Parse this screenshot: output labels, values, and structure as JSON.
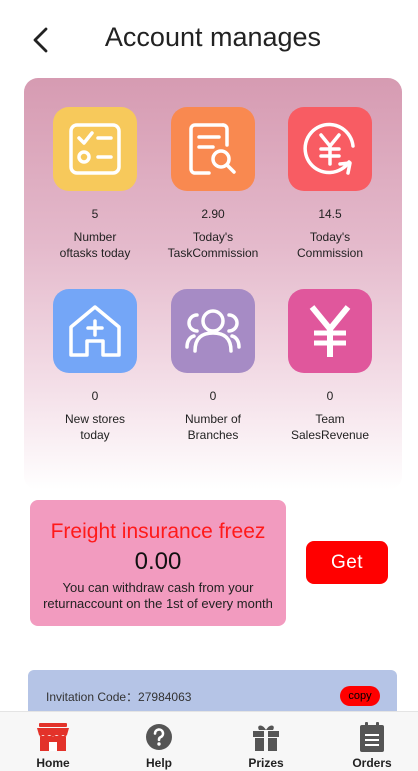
{
  "header": {
    "title": "Account manages"
  },
  "stats": [
    {
      "value": "5",
      "label": "Number\noftasks today",
      "icon": "checklist-icon",
      "color": "#f7c95b"
    },
    {
      "value": "2.90",
      "label": "Today's\nTaskCommission",
      "icon": "document-search-icon",
      "color": "#f98950"
    },
    {
      "value": "14.5",
      "label": "Today's\nCommission",
      "icon": "yen-refresh-icon",
      "color": "#f85c63"
    },
    {
      "value": "0",
      "label": "New stores\ntoday",
      "icon": "store-add-icon",
      "color": "#74a6f7"
    },
    {
      "value": "0",
      "label": "Number of\nBranches",
      "icon": "team-icon",
      "color": "#a68bc5"
    },
    {
      "value": "0",
      "label": "Team\nSalesRevenue",
      "icon": "yen-icon",
      "color": "#e0579c"
    }
  ],
  "freight": {
    "title": "Freight insurance freez",
    "amount": "0.00",
    "description": "You can withdraw cash from your returnaccount on the 1st of every month",
    "button_label": "Get"
  },
  "invitation": {
    "label": "Invitation Code：27984063",
    "copy_label": "copy"
  },
  "tabbar": {
    "items": [
      {
        "label": "Home",
        "icon": "store-icon",
        "active_color": "#e3322a"
      },
      {
        "label": "Help",
        "icon": "question-icon"
      },
      {
        "label": "Prizes",
        "icon": "gift-icon"
      },
      {
        "label": "Orders",
        "icon": "clipboard-icon"
      }
    ]
  }
}
